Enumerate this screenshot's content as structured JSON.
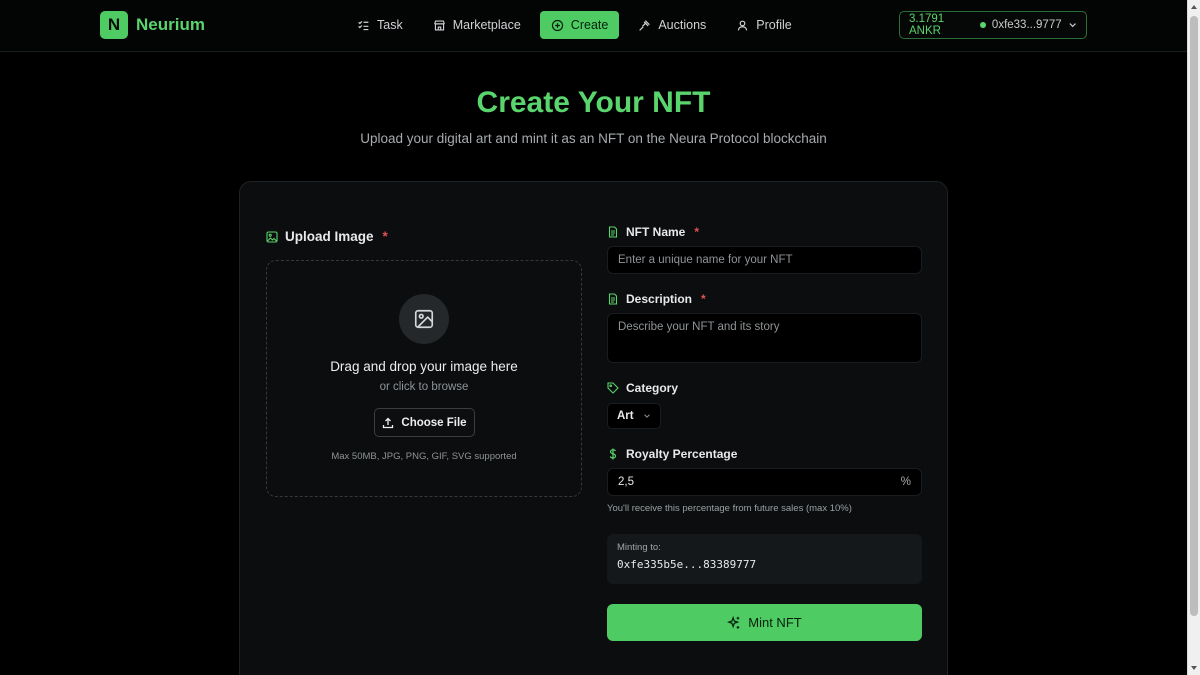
{
  "brand": {
    "logo_letter": "N",
    "name": "Neurium",
    "accent": "#4ecb62"
  },
  "nav": {
    "items": [
      {
        "label": "Task",
        "icon": "list-check-icon"
      },
      {
        "label": "Marketplace",
        "icon": "store-icon"
      },
      {
        "label": "Create",
        "icon": "plus-circle-icon",
        "active": true
      },
      {
        "label": "Auctions",
        "icon": "gavel-icon"
      },
      {
        "label": "Profile",
        "icon": "user-icon"
      }
    ]
  },
  "wallet": {
    "balance": "3.1791 ANKR",
    "address": "0xfe33...9777"
  },
  "hero": {
    "title": "Create Your NFT",
    "subtitle": "Upload your digital art and mint it as an NFT on the Neura Protocol blockchain"
  },
  "upload": {
    "label": "Upload Image",
    "required_mark": "*",
    "drop_title": "Drag and drop your image here",
    "drop_sub": "or click to browse",
    "choose_label": "Choose File",
    "note": "Max 50MB, JPG, PNG, GIF, SVG supported"
  },
  "form": {
    "name_label": "NFT Name",
    "name_placeholder": "Enter a unique name for your NFT",
    "desc_label": "Description",
    "desc_placeholder": "Describe your NFT and its story",
    "required_mark": "*",
    "category_label": "Category",
    "category_value": "Art",
    "royalty_label": "Royalty Percentage",
    "royalty_value": "2,5",
    "royalty_unit": "%",
    "royalty_help": "You'll receive this percentage from future sales (max 10%)",
    "minting_to_label": "Minting to:",
    "minting_to_address": "0xfe335b5e...83389777",
    "mint_label": "Mint NFT"
  }
}
